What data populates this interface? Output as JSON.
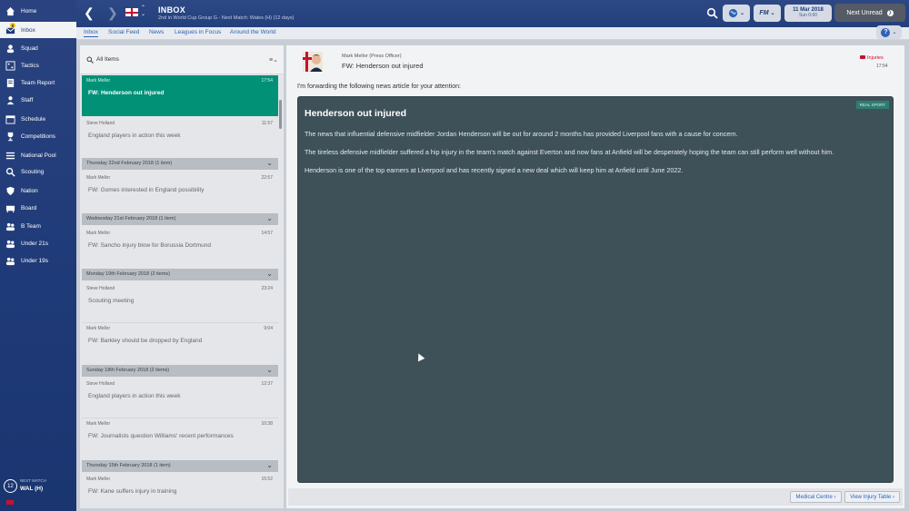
{
  "sidebar": {
    "items": [
      {
        "label": "Home",
        "icon": "home-icon"
      },
      {
        "label": "Inbox",
        "icon": "inbox-icon",
        "badge": "8"
      },
      {
        "label": "Squad",
        "icon": "squad-icon"
      },
      {
        "label": "Tactics",
        "icon": "tactics-icon"
      },
      {
        "label": "Team Report",
        "icon": "team-report-icon"
      },
      {
        "label": "Staff",
        "icon": "staff-icon"
      },
      {
        "label": "Schedule",
        "icon": "schedule-icon"
      },
      {
        "label": "Competitions",
        "icon": "trophy-icon"
      },
      {
        "label": "National Pool",
        "icon": "list-icon"
      },
      {
        "label": "Scouting",
        "icon": "scouting-icon"
      },
      {
        "label": "Nation",
        "icon": "shield-icon"
      },
      {
        "label": "Board",
        "icon": "board-icon"
      },
      {
        "label": "B Team",
        "icon": "team-icon"
      },
      {
        "label": "Under 21s",
        "icon": "team-icon"
      },
      {
        "label": "Under 19s",
        "icon": "team-icon"
      }
    ],
    "next_match": {
      "label": "NEXT MATCH",
      "value": "WAL (H)",
      "days": "12"
    }
  },
  "header": {
    "title": "INBOX",
    "subtitle": "2nd in World Cup Group G - Next Match: Wales (H) (12 days)",
    "date": "11 Mar 2018",
    "day": "Sun 0:00",
    "next_unread": "Next Unread",
    "fm_label": "FM"
  },
  "subnav": {
    "tabs": [
      "Inbox",
      "Social Feed",
      "News",
      "Leagues in Focus",
      "Around the World"
    ]
  },
  "list": {
    "filter_label": "All Items",
    "messages": [
      {
        "from": "Mark Mellor",
        "time": "17:54",
        "subject": "FW: Henderson out injured",
        "selected": true
      },
      {
        "from": "Steve Holland",
        "time": "11:57",
        "subject": "England players in action this week"
      },
      {
        "from": "Mark Mellor",
        "time": "22:57",
        "subject": "FW: Gomes interested in England possibility"
      },
      {
        "from": "Mark Mellor",
        "time": "14:57",
        "subject": "FW: Sancho injury blow for Borussia Dortmund"
      },
      {
        "from": "Steve Holland",
        "time": "23:24",
        "subject": "Scouting meeting"
      },
      {
        "from": "Mark Mellor",
        "time": "9:04",
        "subject": "FW: Barkley should be dropped by England"
      },
      {
        "from": "Steve Holland",
        "time": "12:37",
        "subject": "England players in action this week"
      },
      {
        "from": "Mark Mellor",
        "time": "10:38",
        "subject": "FW: Journalists question Williams' recent performances"
      },
      {
        "from": "Mark Mellor",
        "time": "15:52",
        "subject": "FW: Kane suffers injury in training"
      }
    ],
    "groups": [
      "Thursday 22nd February 2018 (1 item)",
      "Wednesday 21st February 2018 (1 item)",
      "Monday 19th February 2018 (2 items)",
      "Sunday 18th February 2018 (2 items)",
      "Thursday 15th February 2018 (1 item)"
    ]
  },
  "message": {
    "from": "Mark Mellor (Press Officer)",
    "subject": "FW: Henderson out injured",
    "tag": "Injuries",
    "time": "17:54",
    "intro": "I'm forwarding the following news article for your attention:",
    "source": "REAL SPORT",
    "title": "Henderson out injured",
    "paragraphs": [
      "The news that influential defensive midfielder Jordan Henderson will be out for around 2 months has provided Liverpool fans with a cause for concern.",
      "The tireless defensive midfielder suffered a hip injury in the team's match against Everton and now fans at Anfield will be desperately hoping the team can still perform well without him.",
      "Henderson is one of the top earners at Liverpool and has recently signed a new deal which will keep him at Anfield until June 2022."
    ],
    "buttons": [
      "Medical Centre",
      "View Injury Table"
    ]
  },
  "colors": {
    "sidebar": "#1f3a78",
    "selected": "#009177",
    "article_bg": "#3e5159",
    "link": "#2c63b8"
  }
}
